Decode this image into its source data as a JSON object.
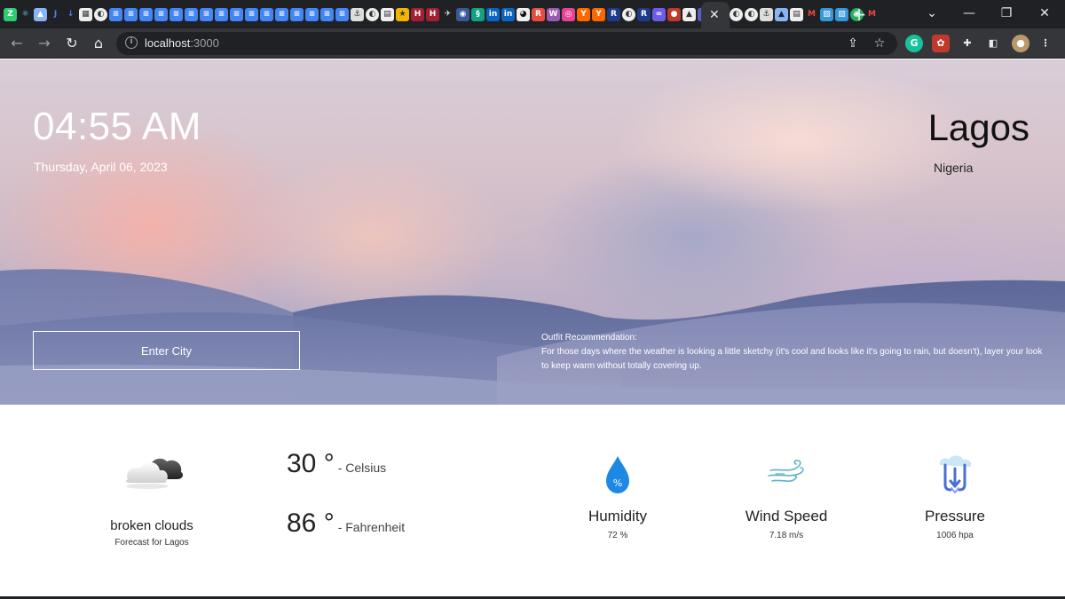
{
  "browser": {
    "url_host": "localhost",
    "url_port": ":3000",
    "close_tab": "✕",
    "new_tab": "+"
  },
  "hero": {
    "time": "04:55 AM",
    "date": "Thursday, April 06, 2023",
    "city": "Lagos",
    "country": "Nigeria",
    "city_input_placeholder": "Enter City",
    "outfit_title": "Outfit Recommendation:",
    "outfit_text": "For those days where the weather is looking a little sketchy (it's cool and looks like it's going to rain, but doesn't), layer your look to keep warm without totally covering up."
  },
  "weather": {
    "condition": "broken clouds",
    "forecast_for": "Forecast for Lagos",
    "celsius_value": "30 °",
    "celsius_label": "- Celsius",
    "fahrenheit_value": "86 °",
    "fahrenheit_label": "- Fahrenheit",
    "humidity_label": "Humidity",
    "humidity_value": "72 %",
    "wind_label": "Wind Speed",
    "wind_value": "7.18 m/s",
    "pressure_label": "Pressure",
    "pressure_value": "1006 hpa",
    "humidity_icon_text": "%"
  },
  "colors": {
    "chrome_dark": "#202124",
    "chrome_toolbar": "#35363a",
    "humidity_blue": "#1e88e5",
    "pressure_blue": "#4a6fd6"
  }
}
